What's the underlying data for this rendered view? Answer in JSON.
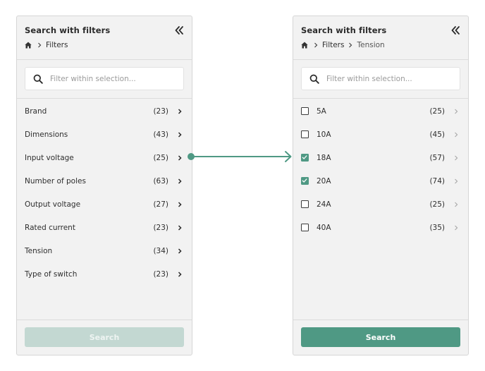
{
  "accent_color": "#4f9984",
  "left_panel": {
    "title": "Search with filters",
    "breadcrumb": [
      "Filters"
    ],
    "search_placeholder": "Filter within selection...",
    "items": [
      {
        "label": "Brand",
        "count": "(23)"
      },
      {
        "label": "Dimensions",
        "count": "(43)"
      },
      {
        "label": "Input voltage",
        "count": "(25)"
      },
      {
        "label": "Number of poles",
        "count": "(63)"
      },
      {
        "label": "Output voltage",
        "count": "(27)"
      },
      {
        "label": "Rated current",
        "count": "(23)"
      },
      {
        "label": "Tension",
        "count": "(34)"
      },
      {
        "label": "Type of switch",
        "count": "(23)"
      }
    ],
    "search_button": "Search",
    "search_button_state": "disabled"
  },
  "right_panel": {
    "title": "Search with filters",
    "breadcrumb": [
      "Filters",
      "Tension"
    ],
    "search_placeholder": "Filter within selection...",
    "items": [
      {
        "label": "5A",
        "count": "(25)",
        "checked": false
      },
      {
        "label": "10A",
        "count": "(45)",
        "checked": false
      },
      {
        "label": "18A",
        "count": "(57)",
        "checked": true
      },
      {
        "label": "20A",
        "count": "(74)",
        "checked": true
      },
      {
        "label": "24A",
        "count": "(25)",
        "checked": false
      },
      {
        "label": "40A",
        "count": "(35)",
        "checked": false
      }
    ],
    "search_button": "Search",
    "search_button_state": "enabled"
  }
}
